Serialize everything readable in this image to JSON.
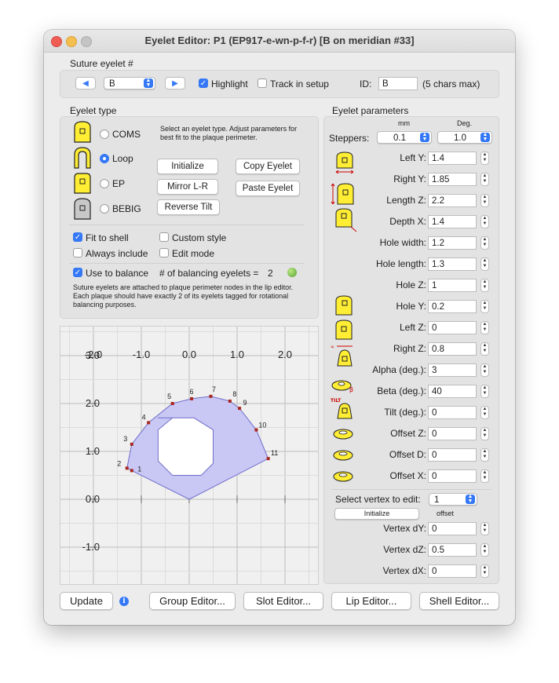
{
  "window": {
    "title": "Eyelet Editor: P1 (EP917-e-wn-p-f-r) [B on meridian #33]"
  },
  "suture": {
    "section_label": "Suture eyelet #",
    "eyelet_selected": "B",
    "highlight_label": "Highlight",
    "highlight_checked": true,
    "track_label": "Track in setup",
    "track_checked": false,
    "id_label": "ID:",
    "id_value": "B",
    "id_hint": "(5 chars max)"
  },
  "eyelet_type": {
    "section_label": "Eyelet type",
    "types": [
      {
        "label": "COMS",
        "selected": false
      },
      {
        "label": "Loop",
        "selected": true
      },
      {
        "label": "EP",
        "selected": false
      },
      {
        "label": "BEBIG",
        "selected": false
      }
    ],
    "instructions": "Select an eyelet type. Adjust parameters for best fit to the plaque perimeter.",
    "buttons": {
      "initialize": "Initialize",
      "copy": "Copy Eyelet",
      "mirror": "Mirror L-R",
      "paste": "Paste Eyelet",
      "reverse": "Reverse Tilt"
    },
    "options": {
      "fit_to_shell": "Fit to shell",
      "custom_style": "Custom style",
      "always_include": "Always include",
      "edit_mode": "Edit mode"
    },
    "balance": {
      "use_label": "Use to balance",
      "count_label": "# of balancing eyelets =",
      "count": "2"
    },
    "note": "Suture eyelets are attached to plaque perimeter nodes in the lip editor. Each plaque should have exactly 2 of its eyelets tagged for rotational balancing purposes."
  },
  "params": {
    "section_label": "Eyelet parameters",
    "col_mm": "mm",
    "col_deg": "Deg.",
    "steppers_label": "Steppers:",
    "stepper_mm": "0.1",
    "stepper_deg": "1.0",
    "rows": [
      {
        "label": "Left Y:",
        "value": "1.4"
      },
      {
        "label": "Right Y:",
        "value": "1.85"
      },
      {
        "label": "Length Z:",
        "value": "2.2"
      },
      {
        "label": "Depth X:",
        "value": "1.4"
      },
      {
        "label": "Hole width:",
        "value": "1.2"
      },
      {
        "label": "Hole length:",
        "value": "1.3"
      },
      {
        "label": "Hole Z:",
        "value": "1"
      },
      {
        "label": "Hole Y:",
        "value": "0.2"
      },
      {
        "label": "Left Z:",
        "value": "0"
      },
      {
        "label": "Right Z:",
        "value": "0.8"
      },
      {
        "label": "Alpha (deg.):",
        "value": "3"
      },
      {
        "label": "Beta (deg.):",
        "value": "40"
      },
      {
        "label": "Tilt (deg.):",
        "value": "0"
      },
      {
        "label": "Offset Z:",
        "value": "0"
      },
      {
        "label": "Offset D:",
        "value": "0"
      },
      {
        "label": "Offset X:",
        "value": "0"
      }
    ],
    "vertex_select_label": "Select vertex to edit:",
    "vertex_selected": "1",
    "vertex_init": "Initialize",
    "offset_label": "offset",
    "vertex_rows": [
      {
        "label": "Vertex dY:",
        "value": "0"
      },
      {
        "label": "Vertex dZ:",
        "value": "0.5"
      },
      {
        "label": "Vertex dX:",
        "value": "0"
      }
    ]
  },
  "plot": {
    "x_ticks": [
      "-2.0",
      "-1.0",
      "0.0",
      "1.0",
      "2.0"
    ],
    "y_ticks": [
      "3.0",
      "2.0",
      "1.0",
      "0.0",
      "-1.0"
    ],
    "outer_polygon": [
      [
        -1.2,
        0.6
      ],
      [
        -1.3,
        0.65
      ],
      [
        -1.2,
        1.15
      ],
      [
        -0.85,
        1.6
      ],
      [
        -0.35,
        2.0
      ],
      [
        0.05,
        2.1
      ],
      [
        0.45,
        2.15
      ],
      [
        0.85,
        2.05
      ],
      [
        1.05,
        1.9
      ],
      [
        1.4,
        1.45
      ],
      [
        1.65,
        0.85
      ],
      [
        0.0,
        0.0
      ]
    ],
    "inner_octagon": [
      [
        -0.65,
        1.7
      ],
      [
        -0.35,
        1.7
      ],
      [
        0.1,
        1.7
      ],
      [
        0.5,
        1.45
      ],
      [
        0.5,
        0.75
      ],
      [
        0.25,
        0.5
      ],
      [
        -0.35,
        0.5
      ],
      [
        -0.65,
        0.8
      ],
      [
        -0.65,
        1.45
      ],
      [
        -0.35,
        1.7
      ]
    ],
    "vertex_labels": [
      "1",
      "2",
      "3",
      "4",
      "5",
      "6",
      "7",
      "8",
      "9",
      "10",
      "11"
    ],
    "fill_color": "#c9c8f5",
    "edge_color": "#6f6cc9",
    "node_color": "#a8261f"
  },
  "footer": {
    "update": "Update",
    "group": "Group Editor...",
    "slot": "Slot Editor...",
    "lip": "Lip Editor...",
    "shell": "Shell Editor..."
  },
  "colors": {
    "accent": "#3478f6",
    "eyelet_yellow": "#ffee33",
    "eyelet_gray": "#c8c8c8",
    "close": "#ee5e55",
    "minimize": "#f4bf4f",
    "zoom": "#c4c4c4"
  }
}
